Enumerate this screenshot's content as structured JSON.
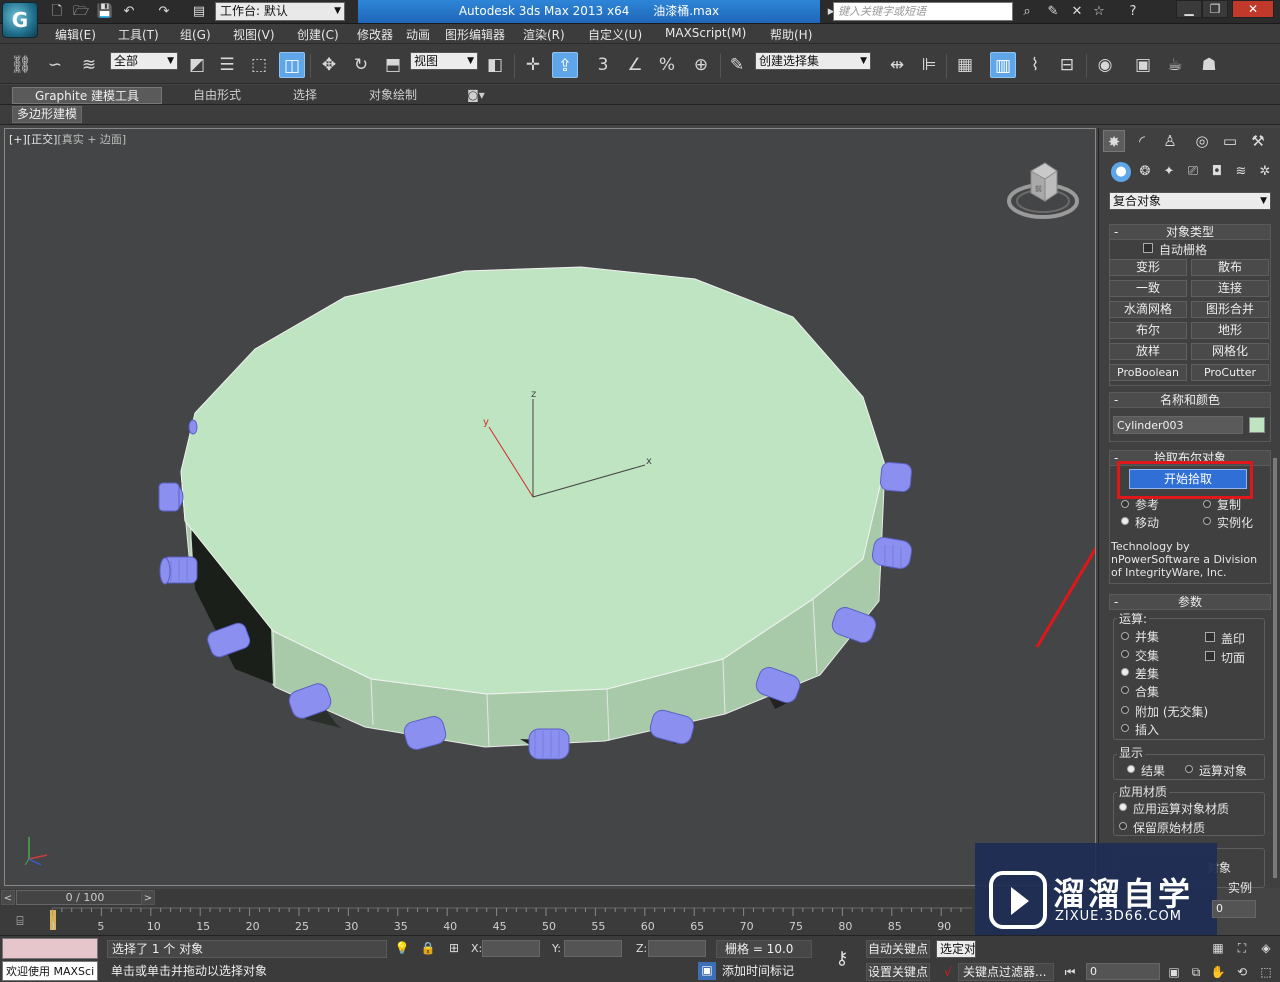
{
  "title_bar": {
    "workspace": "工作台: 默认",
    "app_title": "Autodesk 3ds Max  2013 x64",
    "file_name": "油漆桶.max",
    "search_placeholder": "键入关键字或短语",
    "help_icon": "?"
  },
  "menu": {
    "items": [
      "编辑(E)",
      "工具(T)",
      "组(G)",
      "视图(V)",
      "创建(C)",
      "修改器",
      "动画",
      "图形编辑器",
      "渲染(R)",
      "自定义(U)",
      "MAXScript(M)",
      "帮助(H)"
    ]
  },
  "toolbar": {
    "filter_value": "全部",
    "ref_coord_value": "视图",
    "snap_label": "3",
    "named_selection_value": "创建选择集"
  },
  "ribbon": {
    "tabs": [
      "Graphite 建模工具",
      "自由形式",
      "选择",
      "对象绘制"
    ],
    "sub_label": "多边形建模"
  },
  "viewport": {
    "label_plus": "[+]",
    "label_view": "[正交]",
    "label_shading": "[真实 + 边面]",
    "axis_x": "x",
    "axis_y": "y",
    "axis_z": "z",
    "viewcube_label": "前"
  },
  "command_panel": {
    "category": "复合对象",
    "object_type": {
      "title": "对象类型",
      "autogrid": "自动栅格",
      "buttons": [
        "变形",
        "散布",
        "一致",
        "连接",
        "水滴网格",
        "图形合并",
        "布尔",
        "地形",
        "放样",
        "网格化",
        "ProBoolean",
        "ProCutter"
      ]
    },
    "name_color": {
      "title": "名称和颜色",
      "object_name": "Cylinder003",
      "swatch_color": "#bfe4c1"
    },
    "pick_boolean": {
      "title": "拾取布尔对象",
      "start_pick": "开始拾取",
      "options": [
        "参考",
        "复制",
        "移动",
        "实例化"
      ],
      "credit": "Technology by nPowerSoftware a Division of IntegrityWare, Inc."
    },
    "parameters": {
      "title": "参数",
      "operation_title": "运算:",
      "operations": [
        "并集",
        "交集",
        "差集",
        "合集",
        "附加 (无交集)",
        "插入"
      ],
      "checks": [
        "盖印",
        "切面"
      ],
      "display_title": "显示",
      "display_options": [
        "结果",
        "运算对象"
      ],
      "material_title": "应用材质",
      "material_options": [
        "应用运算对象材质",
        "保留原始材质"
      ],
      "partial_labels": [
        "对象",
        "实例"
      ]
    }
  },
  "watermark": {
    "title": "溜溜自学",
    "url": "ZIXUE.3D66.COM"
  },
  "timeline": {
    "slider_label": "0 / 100",
    "ticks": [
      "0",
      "5",
      "10",
      "15",
      "20",
      "25",
      "30",
      "35",
      "40",
      "45",
      "50",
      "55",
      "60",
      "65",
      "70",
      "75",
      "80",
      "85",
      "90"
    ]
  },
  "status_bar": {
    "welcome": "欢迎使用 MAXSci",
    "selection": "选择了 1 个 对象",
    "prompt": "单击或单击并拖动以选择对象",
    "x_label": "X:",
    "y_label": "Y:",
    "z_label": "Z:",
    "grid": "栅格 = 10.0",
    "add_time_tag": "添加时间标记",
    "auto_key": "自动关键点",
    "set_key": "设置关键点",
    "selected": "选定对",
    "key_filters": "关键点过滤器...",
    "frame": "0",
    "spinner_value": "0"
  },
  "colors": {
    "cylinder_top": "#bfe4c1",
    "cylinder_side": "#a9caa9",
    "small_cylinders": "#8a8ff0",
    "annotation_red": "#e0161a",
    "highlight_blue": "#2f6fd6"
  }
}
